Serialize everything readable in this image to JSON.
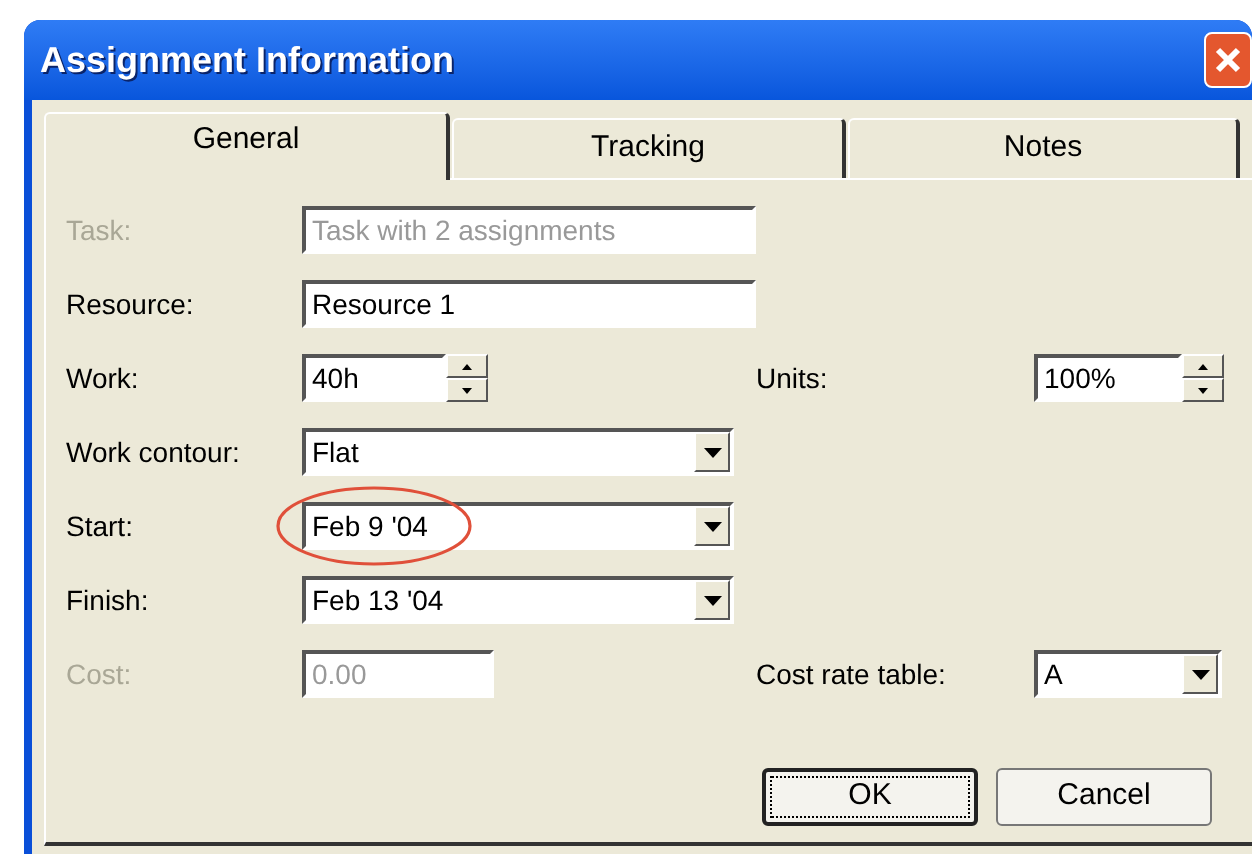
{
  "window": {
    "title": "Assignment Information"
  },
  "tabs": [
    {
      "label": "General",
      "selected": true
    },
    {
      "label": "Tracking",
      "selected": false
    },
    {
      "label": "Notes",
      "selected": false
    }
  ],
  "rows": [
    {
      "fields": [
        {
          "label": "Task:",
          "kind": "wide_text",
          "value": "Task with 2 assignments",
          "disabled": true
        }
      ]
    },
    {
      "fields": [
        {
          "label": "Resource:",
          "kind": "wide_text",
          "value": "Resource 1",
          "disabled": false
        }
      ]
    },
    {
      "fields": [
        {
          "label": "Work:",
          "kind": "spin",
          "value": "40h",
          "disabled": false
        },
        {
          "label": "Units:",
          "kind": "spin",
          "value": "100%",
          "disabled": false
        }
      ]
    },
    {
      "fields": [
        {
          "label": "Work contour:",
          "kind": "dropdown",
          "value": "Flat",
          "disabled": false,
          "highlighted": false
        }
      ]
    },
    {
      "fields": [
        {
          "label": "Start:",
          "kind": "dropdown",
          "value": "Feb 9 '04",
          "disabled": false,
          "highlighted": true
        }
      ]
    },
    {
      "fields": [
        {
          "label": "Finish:",
          "kind": "dropdown",
          "value": "Feb 13 '04",
          "disabled": false,
          "highlighted": false
        }
      ]
    },
    {
      "fields": [
        {
          "label": "Cost:",
          "kind": "short_text",
          "value": "0.00",
          "disabled": true
        },
        {
          "label": "Cost rate table:",
          "kind": "dropdown",
          "value": "A",
          "disabled": false,
          "highlighted": false
        }
      ]
    }
  ],
  "buttons": [
    {
      "label": "OK",
      "focused": true
    },
    {
      "label": "Cancel",
      "focused": false
    }
  ]
}
